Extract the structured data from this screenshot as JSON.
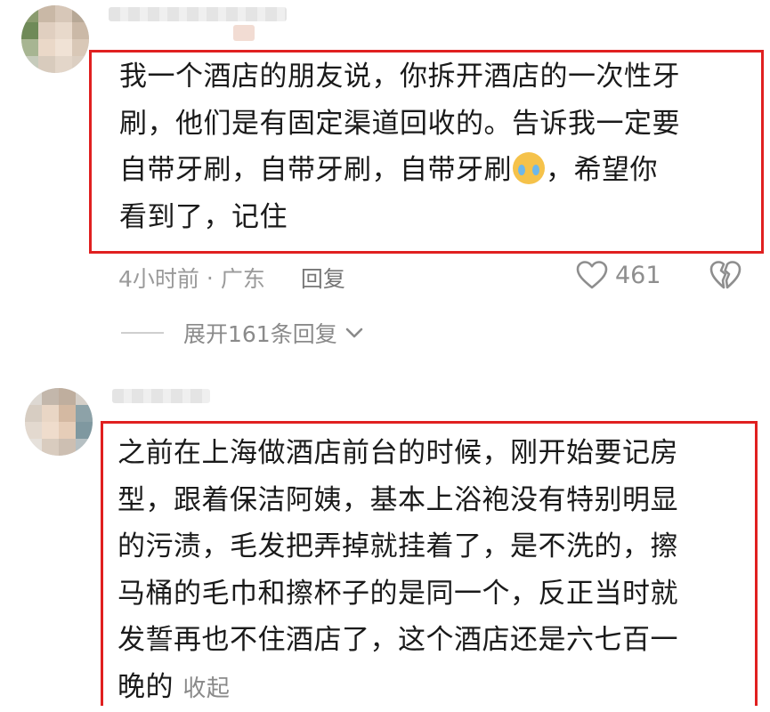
{
  "comments": [
    {
      "text_lines": [
        "我一个酒店的朋友说，你拆开酒店的一次性牙",
        "刷，他们是有固定渠道回收的。告诉我一定要",
        "自带牙刷，自带牙刷，自带牙刷",
        "，希望你",
        "看到了，记住"
      ],
      "emoji": "crying-face-emoji",
      "time": "4小时前",
      "separator": "·",
      "location": "广东",
      "reply_label": "回复",
      "like_count": "461",
      "expand_replies_label": "展开161条回复"
    },
    {
      "text_lines": [
        "之前在上海做酒店前台的时候，刚开始要记房",
        "型，跟着保洁阿姨，基本上浴袍没有特别明显",
        "的污渍，毛发把弄掉就挂着了，是不洗的，擦",
        "马桶的毛巾和擦杯子的是同一个，反正当时就",
        "发誓再也不住酒店了，这个酒店还是六七百一",
        "晚的"
      ],
      "collapse_label": "收起"
    }
  ],
  "icons": [
    "heart-outline-icon",
    "broken-heart-icon",
    "chevron-down-icon"
  ],
  "colors": {
    "highlight_border": "#e02020",
    "meta_text": "#9a9a9a"
  }
}
